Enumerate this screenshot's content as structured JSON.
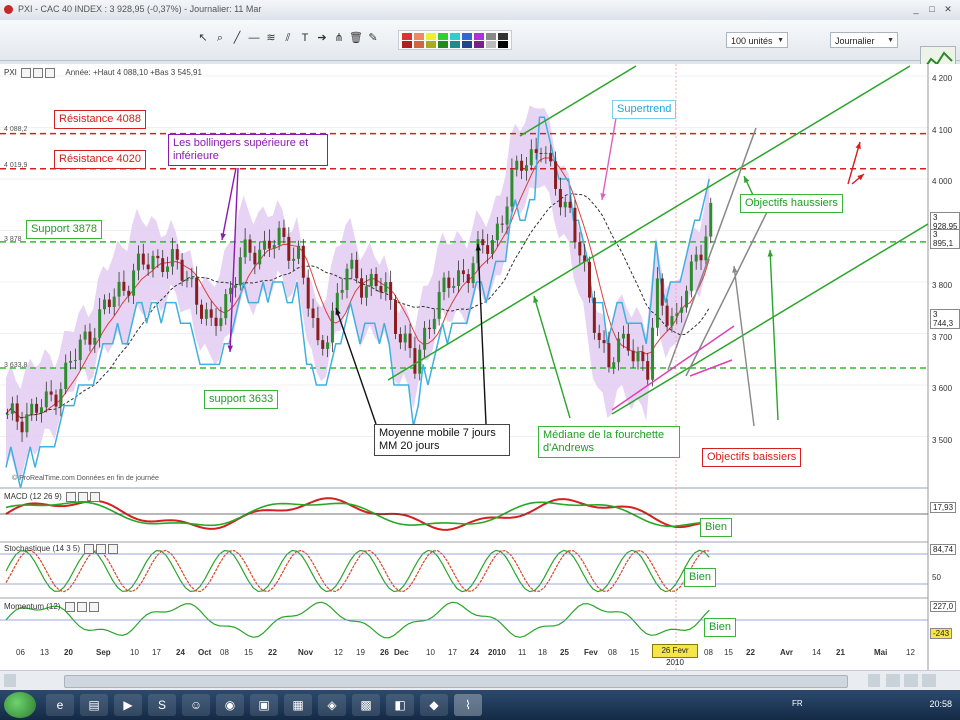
{
  "window": {
    "title": "PXI - CAC 40 INDEX : 3 928,95 (-0,37%) - Journalier: 11 Mar"
  },
  "toolbar": {
    "units_select": "100 unités",
    "period_select": "Journalier"
  },
  "chart": {
    "header_name": "PXI",
    "header_info": "Année: +Haut 4 088,10 +Bas 3 545,91",
    "watermark": "© ProRealTime.com  Données en fin de journée",
    "y_labels": [
      "4 200",
      "4 100",
      "4 000",
      "3 900",
      "3 800",
      "3 700",
      "3 600",
      "3 500"
    ],
    "y_level_tags": [
      "4 088,2",
      "4 019,9",
      "3 878",
      "3 633,8"
    ],
    "y_tags": [
      "3 928,95",
      "3 895,1",
      "3 744,3"
    ],
    "x_labels": [
      "06",
      "13",
      "20",
      "Sep",
      "10",
      "17",
      "24",
      "Oct",
      "08",
      "15",
      "22",
      "Nov",
      "12",
      "19",
      "26",
      "Dec",
      "10",
      "17",
      "24",
      "2010",
      "11",
      "18",
      "25",
      "Fev",
      "08",
      "15",
      "22",
      "29",
      "08",
      "15",
      "22",
      "Avr",
      "14",
      "21",
      "Mai",
      "12"
    ],
    "cursor_date": "26 Fevr 2010"
  },
  "annotations": {
    "resistance_4088": "Résistance 4088",
    "resistance_4020": "Résistance 4020",
    "support_3878": "Support 3878",
    "support_3633": "support 3633",
    "bollinger": "Les bollingers supérieure et inférieure",
    "supertrend": "Supertrend",
    "moving_avg": "Moyenne mobile 7 jours MM 20 jours",
    "andrews": "Médiane de la fourchette d'Andrews",
    "objectifs_haussiers": "Objectifs haussiers",
    "objectifs_baissiers": "Objectifs baissiers",
    "bien_macd": "Bien",
    "bien_stoch": "Bien",
    "bien_momentum": "Bien"
  },
  "indicators": {
    "macd": {
      "name": "MACD (12 26 9)",
      "tag": "17,93"
    },
    "stoch": {
      "name": "Stochastique (14 3 5)",
      "tags": [
        "84,74",
        "50"
      ]
    },
    "momentum": {
      "name": "Momentum (12)",
      "tags": [
        "227,0",
        "-243"
      ]
    }
  },
  "taskbar": {
    "lang": "FR",
    "clock": "20:58"
  },
  "colors": {
    "bollinger_fill": "#e3cdf2",
    "resistance": "#d32020",
    "support": "#34b834",
    "supertrend": "#e020d0",
    "mm7": "#d94040",
    "mm20": "#333333",
    "andrews": "#2aa52a"
  }
}
